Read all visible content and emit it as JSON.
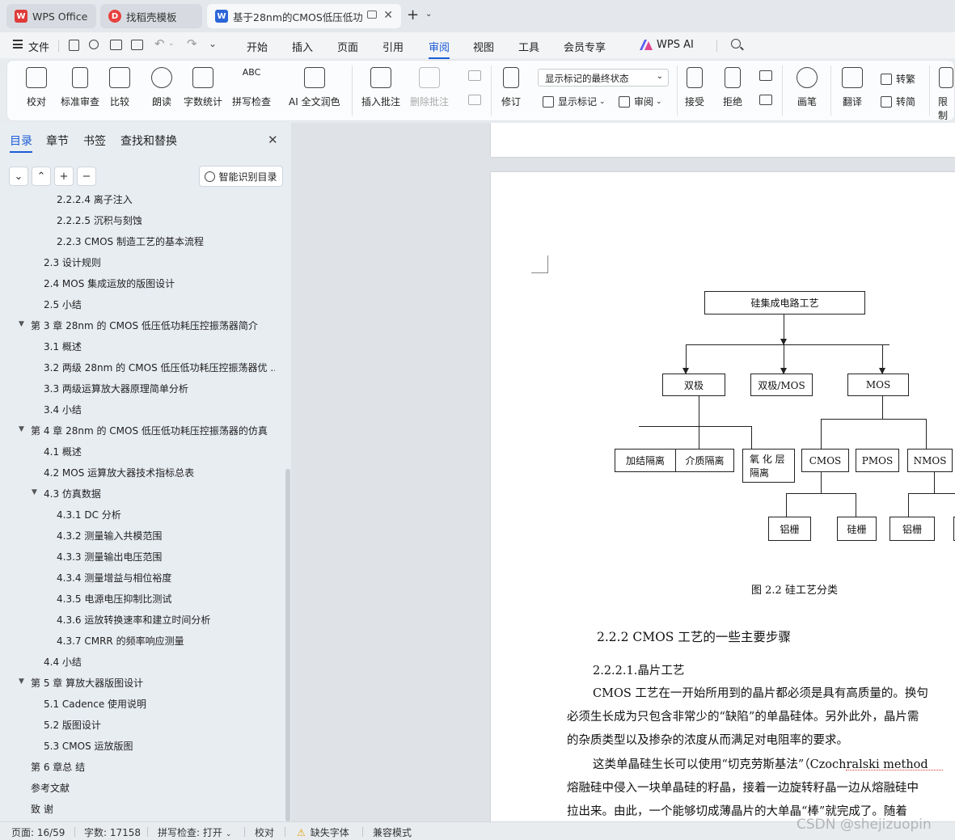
{
  "tabs": [
    {
      "label": "WPS Office",
      "icon": "wps-logo-icon"
    },
    {
      "label": "找稻壳模板",
      "icon": "docer-icon"
    },
    {
      "label": "基于28nm的CMOS低压低功",
      "icon": "word-doc-icon"
    }
  ],
  "menu": {
    "file": "文件",
    "items": [
      "开始",
      "插入",
      "页面",
      "引用",
      "审阅",
      "视图",
      "工具",
      "会员专享"
    ],
    "active": "审阅",
    "wps_ai": "WPS AI"
  },
  "ribbon": {
    "proofread": "校对",
    "standard_review": "标准审查",
    "compare": "比较",
    "read_aloud": "朗读",
    "word_count": "字数统计",
    "spell_check": "拼写检查",
    "ai_polish": "AI 全文润色",
    "insert_comment": "插入批注",
    "delete_comment": "删除批注",
    "track_changes": "修订",
    "markup_mode": "显示标记的最终状态",
    "show_markup": "显示标记",
    "review_pane": "审阅",
    "accept": "接受",
    "reject": "拒绝",
    "ink": "画笔",
    "translate": "翻译",
    "to_traditional": "转繁",
    "to_simplified": "转简",
    "restrict": "限制"
  },
  "sidebar": {
    "tabs": [
      "目录",
      "章节",
      "书签",
      "查找和替换"
    ],
    "active_tab": "目录",
    "smart_toc": "智能识别目录",
    "toc": [
      {
        "text": "2.2.2.4  离子注入",
        "level": 3
      },
      {
        "text": "2.2.2.5  沉积与刻蚀",
        "level": 3
      },
      {
        "text": "2.2.3    CMOS 制造工艺的基本流程",
        "level": 3
      },
      {
        "text": "2.3  设计规则",
        "level": 2
      },
      {
        "text": "2.4 MOS 集成运放的版图设计",
        "level": 2
      },
      {
        "text": "2.5  小结",
        "level": 2
      },
      {
        "text": "第 3 章  28nm 的 CMOS 低压低功耗压控振荡器简介",
        "level": 1,
        "expanded": true
      },
      {
        "text": "3.1  概述",
        "level": 2
      },
      {
        "text": "3.2 两级 28nm 的 CMOS 低压低功耗压控振荡器优 ...",
        "level": 2
      },
      {
        "text": "3.3  两级运算放大器原理简单分析",
        "level": 2
      },
      {
        "text": "3.4  小结",
        "level": 2
      },
      {
        "text": "第 4 章  28nm 的 CMOS 低压低功耗压控振荡器的仿真",
        "level": 1,
        "expanded": true
      },
      {
        "text": "4.1  概述",
        "level": 2
      },
      {
        "text": "4.2 MOS 运算放大器技术指标总表",
        "level": 2
      },
      {
        "text": "4.3 仿真数据",
        "level": 2,
        "expanded": true
      },
      {
        "text": "4.3.1 DC 分析",
        "level": 3
      },
      {
        "text": "4.3.2 测量输入共模范围",
        "level": 3
      },
      {
        "text": "4.3.3  测量输出电压范围",
        "level": 3
      },
      {
        "text": "4.3.4  测量增益与相位裕度",
        "level": 3
      },
      {
        "text": "4.3.5  电源电压抑制比测试",
        "level": 3
      },
      {
        "text": "4.3.6  运放转换速率和建立时间分析",
        "level": 3
      },
      {
        "text": "4.3.7 CMRR 的频率响应测量",
        "level": 3
      },
      {
        "text": "4.4  小结",
        "level": 2
      },
      {
        "text": "第 5 章  算放大器版图设计",
        "level": 1,
        "expanded": true
      },
      {
        "text": "5.1 Cadence 使用说明",
        "level": 2
      },
      {
        "text": "5.2  版图设计",
        "level": 2
      },
      {
        "text": "5.3 CMOS 运放版图",
        "level": 2
      },
      {
        "text": "第 6 章总  结",
        "level": 1
      },
      {
        "text": "参考文献",
        "level": 1
      },
      {
        "text": "致    谢",
        "level": 1
      }
    ]
  },
  "diagram": {
    "root": "硅集成电路工艺",
    "bipolar": "双极",
    "bimos": "双极/MOS",
    "mos": "MOS",
    "pn_isolation": "加结隔离",
    "dielectric_isolation": "介质隔离",
    "oxide_isolation_1": "氧 化 层",
    "oxide_isolation_2": "隔离",
    "cmos": "CMOS",
    "pmos": "PMOS",
    "nmos": "NMOS",
    "al_gate_1": "铝栅",
    "si_gate": "硅栅",
    "al_gate_2": "铝栅",
    "caption": "图 2.2  硅工艺分类"
  },
  "document": {
    "heading": "2.2.2 CMOS 工艺的一些主要步骤",
    "subheading": "2.2.2.1.晶片工艺",
    "lines": [
      "CMOS 工艺在一开始所用到的晶片都必须是具有高质量的。换句",
      "必须生长成为只包含非常少的“缺陷”的单晶硅体。另外此外，晶片需",
      "的杂质类型以及掺杂的浓度从而满足对电阻率的要求。",
      "这类单晶硅生长可以使用“切克劳斯基法”（Czochralski method",
      "熔融硅中侵入一块单晶硅的籽晶，接着一边旋转籽晶一边从熔融硅中",
      "拉出来。由此，一个能够切成薄晶片的大单晶“棒”就完成了。随着"
    ]
  },
  "status": {
    "page": "页面: 16/59",
    "words": "字数: 17158",
    "spell": "拼写检查: 打开",
    "proof": "校对",
    "missing_font": "缺失字体",
    "compat": "兼容模式",
    "watermark": "CSDN @shejizuopin"
  }
}
